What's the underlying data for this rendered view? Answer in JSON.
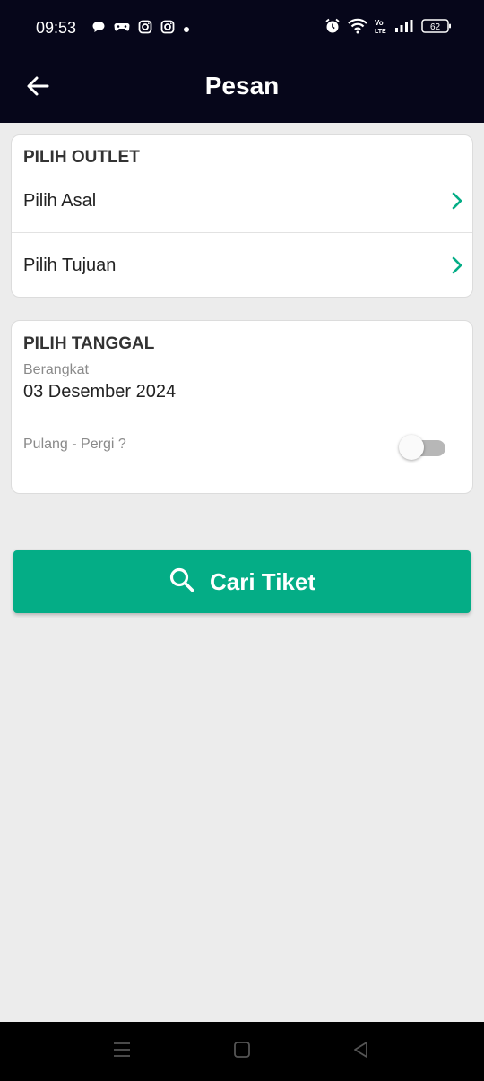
{
  "status_bar": {
    "time": "09:53",
    "battery": "62",
    "left_icons": [
      "chat-bubble-icon",
      "game-controller-icon",
      "instagram-icon",
      "instagram-icon",
      "dot-icon"
    ],
    "right_icons": [
      "alarm-icon",
      "wifi-icon",
      "volte-icon",
      "signal-icon",
      "battery-icon"
    ]
  },
  "app_bar": {
    "title": "Pesan",
    "back_icon": "arrow-left-icon",
    "background": "#06061a"
  },
  "outlet_section": {
    "title": "PILIH OUTLET",
    "origin_label": "Pilih Asal",
    "destination_label": "Pilih Tujuan",
    "chevron_icon": "chevron-right-icon"
  },
  "date_section": {
    "title": "PILIH TANGGAL",
    "departure_label": "Berangkat",
    "departure_value": "03 Desember 2024",
    "round_trip_label": "Pulang - Pergi ?",
    "round_trip_enabled": false
  },
  "search_button": {
    "label": "Cari Tiket",
    "icon": "search-icon",
    "color": "#04ad86"
  },
  "nav_bar": {
    "icons": [
      "menu-icon",
      "home-square-icon",
      "back-triangle-icon"
    ]
  },
  "colors": {
    "accent": "#04ad86",
    "page_background": "#ececec"
  }
}
